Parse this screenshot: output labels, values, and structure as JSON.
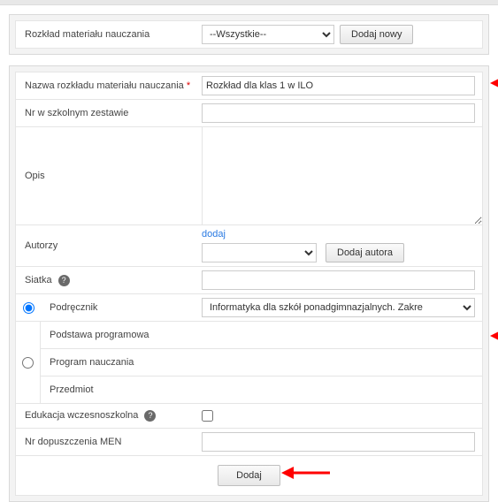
{
  "top": {
    "label": "Rozkład materiału nauczania",
    "select_value": "--Wszystkie--",
    "add_btn": "Dodaj nowy"
  },
  "form": {
    "name_label": "Nazwa rozkładu materiału nauczania",
    "name_value": "Rozkład dla klas 1 w ILO",
    "set_label": "Nr w szkolnym zestawie",
    "set_value": "",
    "desc_label": "Opis",
    "desc_value": "",
    "authors_label": "Autorzy",
    "authors_add_link": "dodaj",
    "authors_select": "",
    "authors_btn": "Dodaj autora",
    "grid_label": "Siatka",
    "grid_value": "",
    "textbook_label": "Podręcznik",
    "textbook_value": "Informatyka dla szkół ponadgimnazjalnych. Zakre",
    "core_label": "Podstawa programowa",
    "program_label": "Program nauczania",
    "subject_label": "Przedmiot",
    "early_label": "Edukacja wczesnoszkolna",
    "early_checked": false,
    "men_label": "Nr dopuszczenia MEN",
    "men_value": "",
    "submit": "Dodaj"
  },
  "icons": {
    "help": "?"
  }
}
